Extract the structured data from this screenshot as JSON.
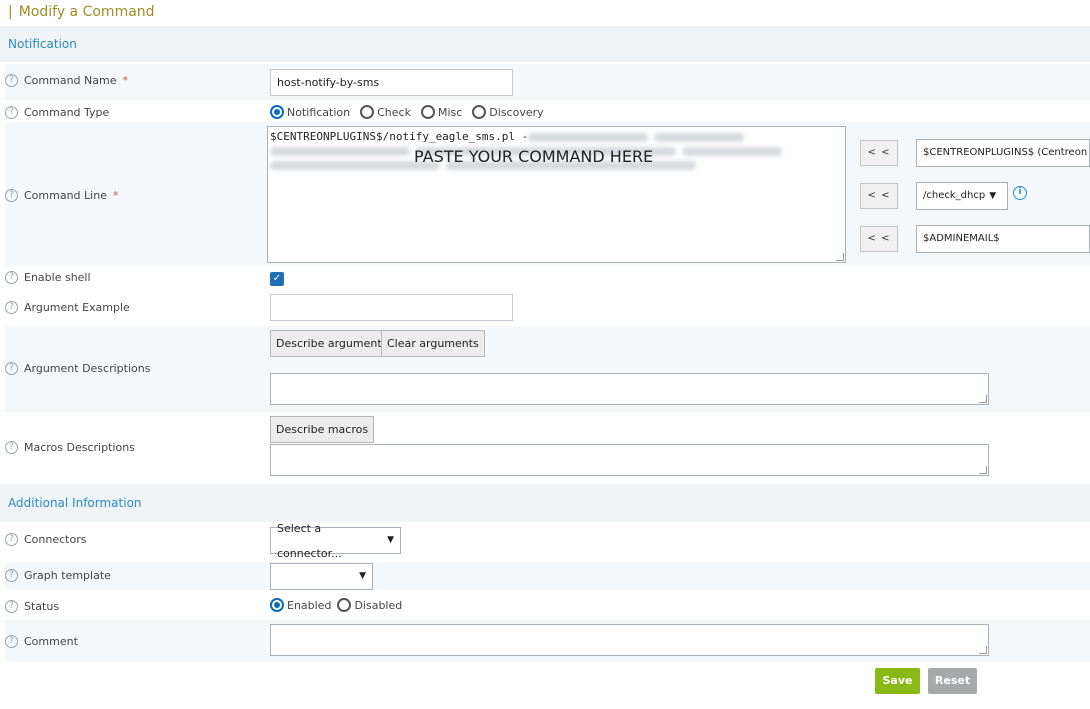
{
  "page": {
    "title": "Modify a Command"
  },
  "sections": {
    "notification": "Notification",
    "additional": "Additional Information"
  },
  "fields": {
    "command_name": {
      "label": "Command Name",
      "required": "*",
      "value": "host-notify-by-sms"
    },
    "command_type": {
      "label": "Command Type",
      "options": [
        "Notification",
        "Check",
        "Misc",
        "Discovery"
      ],
      "selected": "Notification"
    },
    "command_line": {
      "label": "Command Line",
      "required": "*",
      "visible_text": "$CENTREONPLUGINS$/notify_eagle_sms.pl -",
      "overlay_note": "PASTE YOUR COMMAND HERE",
      "arrow_label": "< <",
      "macro_select_1": "$CENTREONPLUGINS$ (Centreon",
      "macro_select_2": "/check_dhcp",
      "macro_select_3": "$ADMINEMAIL$"
    },
    "enable_shell": {
      "label": "Enable shell",
      "checked": true
    },
    "argument_example": {
      "label": "Argument Example",
      "value": ""
    },
    "argument_descriptions": {
      "label": "Argument Descriptions",
      "describe_button": "Describe arguments",
      "clear_button": "Clear arguments"
    },
    "macros_descriptions": {
      "label": "Macros Descriptions",
      "describe_button": "Describe macros"
    },
    "connectors": {
      "label": "Connectors",
      "placeholder": "Select a connector..."
    },
    "graph_template": {
      "label": "Graph template",
      "value": ""
    },
    "status": {
      "label": "Status",
      "options": [
        "Enabled",
        "Disabled"
      ],
      "selected": "Enabled"
    },
    "comment": {
      "label": "Comment",
      "value": ""
    }
  },
  "actions": {
    "save": "Save",
    "reset": "Reset"
  },
  "colors": {
    "title": "#a08c26",
    "section": "#2b8cc4",
    "save": "#88b917",
    "reset": "#a6a8aa"
  },
  "icons": {
    "help": "question-circle-icon",
    "info": "info-circle-icon",
    "dropdown": "chevron-down-icon"
  }
}
